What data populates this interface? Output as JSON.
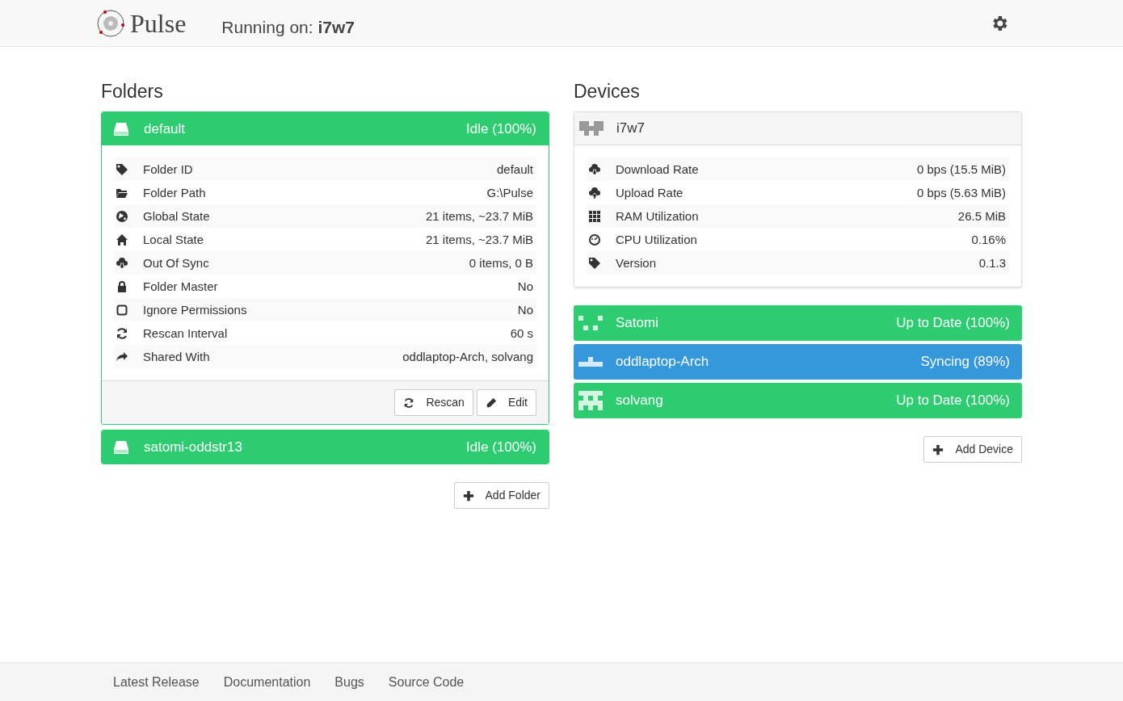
{
  "header": {
    "brand": "Pulse",
    "running_label": "Running on:",
    "running_device": "i7w7"
  },
  "folders": {
    "title": "Folders",
    "items": [
      {
        "name": "default",
        "status": "Idle (100%)",
        "expanded": true,
        "color": "#2ecc71",
        "rows": [
          {
            "label": "Folder ID",
            "value": "default"
          },
          {
            "label": "Folder Path",
            "value": "G:\\Pulse"
          },
          {
            "label": "Global State",
            "value": "21 items, ~23.7 MiB"
          },
          {
            "label": "Local State",
            "value": "21 items, ~23.7 MiB"
          },
          {
            "label": "Out Of Sync",
            "value": "0 items, 0 B"
          },
          {
            "label": "Folder Master",
            "value": "No"
          },
          {
            "label": "Ignore Permissions",
            "value": "No"
          },
          {
            "label": "Rescan Interval",
            "value": "60 s"
          },
          {
            "label": "Shared With",
            "value": "oddlaptop-Arch, solvang"
          }
        ],
        "buttons": [
          "Rescan",
          "Edit"
        ]
      },
      {
        "name": "satomi-oddstr13",
        "status": "Idle (100%)",
        "expanded": false,
        "color": "#2ecc71"
      }
    ],
    "add_button": "Add Folder"
  },
  "devices": {
    "title": "Devices",
    "this_device": {
      "name": "i7w7",
      "rows": [
        {
          "label": "Download Rate",
          "value": "0 bps (15.5 MiB)"
        },
        {
          "label": "Upload Rate",
          "value": "0 bps (5.63 MiB)"
        },
        {
          "label": "RAM Utilization",
          "value": "26.5 MiB"
        },
        {
          "label": "CPU Utilization",
          "value": "0.16%"
        },
        {
          "label": "Version",
          "value": "0.1.3"
        }
      ]
    },
    "items": [
      {
        "name": "Satomi",
        "status": "Up to Date (100%)",
        "color": "#2ecc71"
      },
      {
        "name": "oddlaptop-Arch",
        "status": "Syncing (89%)",
        "color": "#3498db"
      },
      {
        "name": "solvang",
        "status": "Up to Date (100%)",
        "color": "#2ecc71"
      }
    ],
    "add_button": "Add Device"
  },
  "footer": {
    "links": [
      "Latest Release",
      "Documentation",
      "Bugs",
      "Source Code"
    ]
  }
}
